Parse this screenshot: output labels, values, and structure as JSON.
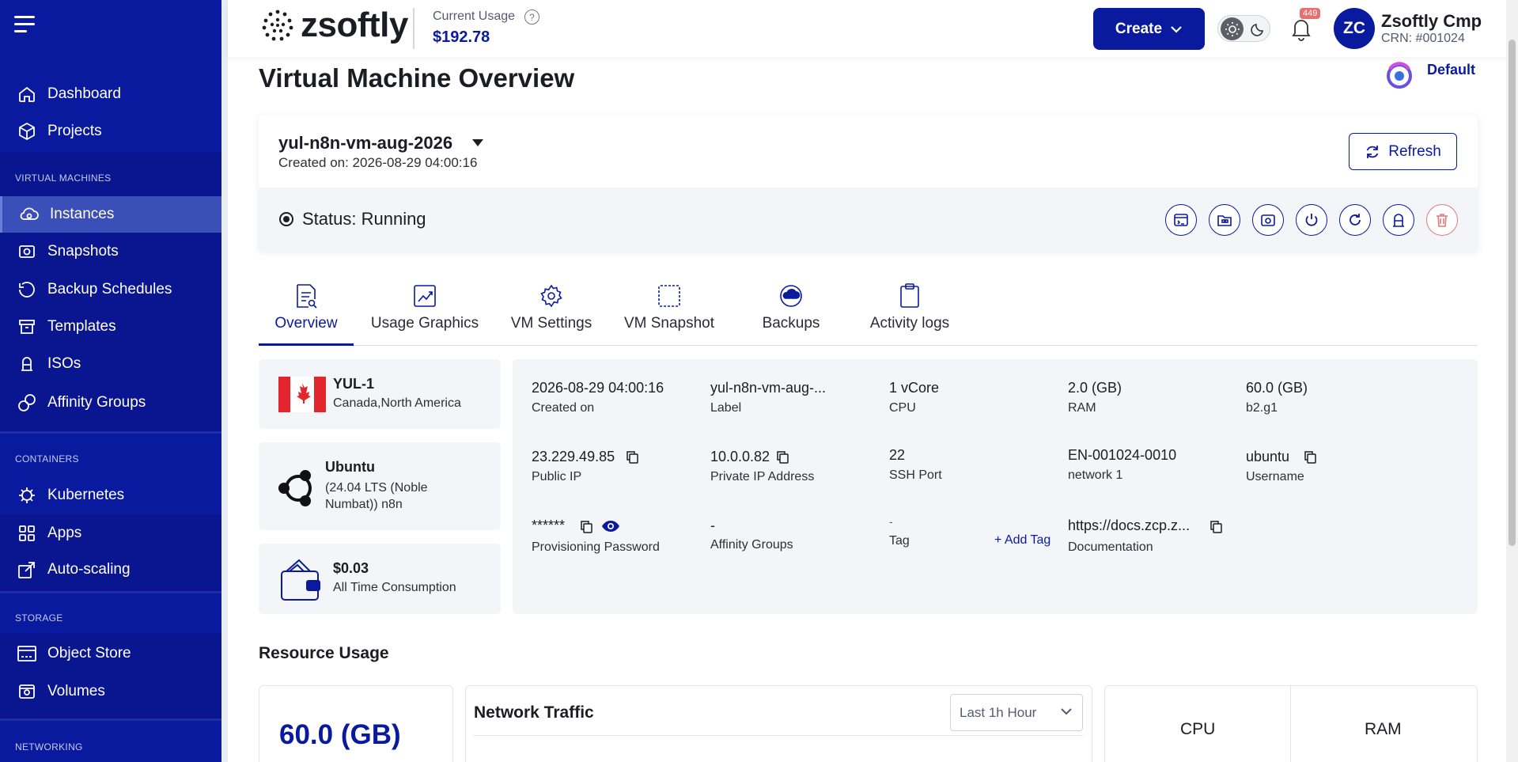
{
  "app": {
    "logo_text": "zsoftly"
  },
  "header": {
    "usage_label": "Current Usage",
    "usage_value": "$192.78",
    "create_label": "Create",
    "notification_count": "449",
    "avatar_initials": "ZC",
    "user_name": "Zsoftly Cmp",
    "user_crn": "CRN: #001024"
  },
  "sidebar": {
    "items": [
      {
        "label": "Dashboard",
        "icon": "home-icon"
      },
      {
        "label": "Projects",
        "icon": "cube-icon"
      }
    ],
    "virtual_machines": {
      "title": "VIRTUAL MACHINES",
      "items": [
        {
          "label": "Instances",
          "icon": "cloud-icon",
          "active": true
        },
        {
          "label": "Snapshots",
          "icon": "snapshot-icon"
        },
        {
          "label": "Backup Schedules",
          "icon": "history-icon"
        },
        {
          "label": "Templates",
          "icon": "archive-icon"
        },
        {
          "label": "ISOs",
          "icon": "iso-icon"
        },
        {
          "label": "Affinity Groups",
          "icon": "affinity-icon"
        }
      ]
    },
    "containers": {
      "title": "CONTAINERS",
      "items": [
        {
          "label": "Kubernetes",
          "icon": "helm-icon"
        },
        {
          "label": "Apps",
          "icon": "apps-grid-icon"
        },
        {
          "label": "Auto-scaling",
          "icon": "autoscale-icon"
        }
      ]
    },
    "storage": {
      "title": "STORAGE",
      "items": [
        {
          "label": "Object Store",
          "icon": "object-store-icon"
        },
        {
          "label": "Volumes",
          "icon": "volume-icon"
        }
      ]
    },
    "networking": {
      "title": "NETWORKING"
    }
  },
  "page": {
    "title": "Virtual Machine Overview",
    "project_label": "Default"
  },
  "vm": {
    "name": "yul-n8n-vm-aug-2026",
    "created": "Created on: 2026-08-29 04:00:16",
    "refresh_label": "Refresh",
    "status": "Status: Running",
    "actions": [
      "console-icon",
      "iso-attach-icon",
      "snapshot-icon",
      "power-icon",
      "reboot-icon",
      "reset-password-icon",
      "delete-icon"
    ]
  },
  "tabs": [
    {
      "label": "Overview",
      "icon": "overview-icon",
      "active": true
    },
    {
      "label": "Usage Graphics",
      "icon": "chart-icon"
    },
    {
      "label": "VM Settings",
      "icon": "gear-icon"
    },
    {
      "label": "VM Snapshot",
      "icon": "snapshot-icon"
    },
    {
      "label": "Backups",
      "icon": "backup-icon"
    },
    {
      "label": "Activity logs",
      "icon": "clipboard-icon"
    }
  ],
  "location": {
    "code": "YUL-1",
    "region": "Canada,North America",
    "flag": "canada-flag"
  },
  "os": {
    "name": "Ubuntu",
    "version": "(24.04 LTS (Noble Numbat)) n8n"
  },
  "consumption": {
    "value": "$0.03",
    "label": "All Time Consumption"
  },
  "details": {
    "created_on": {
      "value": "2026-08-29 04:00:16",
      "label": "Created on"
    },
    "label": {
      "value": "yul-n8n-vm-aug-...",
      "label": "Label"
    },
    "cpu": {
      "value": "1 vCore",
      "label": "CPU"
    },
    "ram": {
      "value": "2.0 (GB)",
      "label": "RAM"
    },
    "disk": {
      "value": "60.0 (GB)",
      "label": "b2.g1"
    },
    "public_ip": {
      "value": "23.229.49.85",
      "label": "Public IP"
    },
    "private_ip": {
      "value": "10.0.0.82",
      "label": "Private IP Address"
    },
    "ssh_port": {
      "value": "22",
      "label": "SSH Port"
    },
    "network": {
      "value": "EN-001024-0010",
      "label": "network 1"
    },
    "username": {
      "value": "ubuntu",
      "label": "Username"
    },
    "password": {
      "value": "******",
      "label": "Provisioning Password"
    },
    "affinity": {
      "value": "-",
      "label": "Affinity Groups"
    },
    "tag": {
      "value": "-",
      "label": "Tag",
      "add_label": "+ Add Tag"
    },
    "documentation": {
      "value": "https://docs.zcp.z...",
      "label": "Documentation"
    }
  },
  "resource_usage": {
    "title": "Resource Usage",
    "disk_value": "60.0 (GB)",
    "network_traffic_title": "Network Traffic",
    "range_select": "Last 1h Hour",
    "cpu_label": "CPU",
    "ram_label": "RAM"
  },
  "colors": {
    "brand": "#0a1a9e",
    "sidebar_active": "#3a4fb8",
    "danger": "#e17a7a"
  }
}
